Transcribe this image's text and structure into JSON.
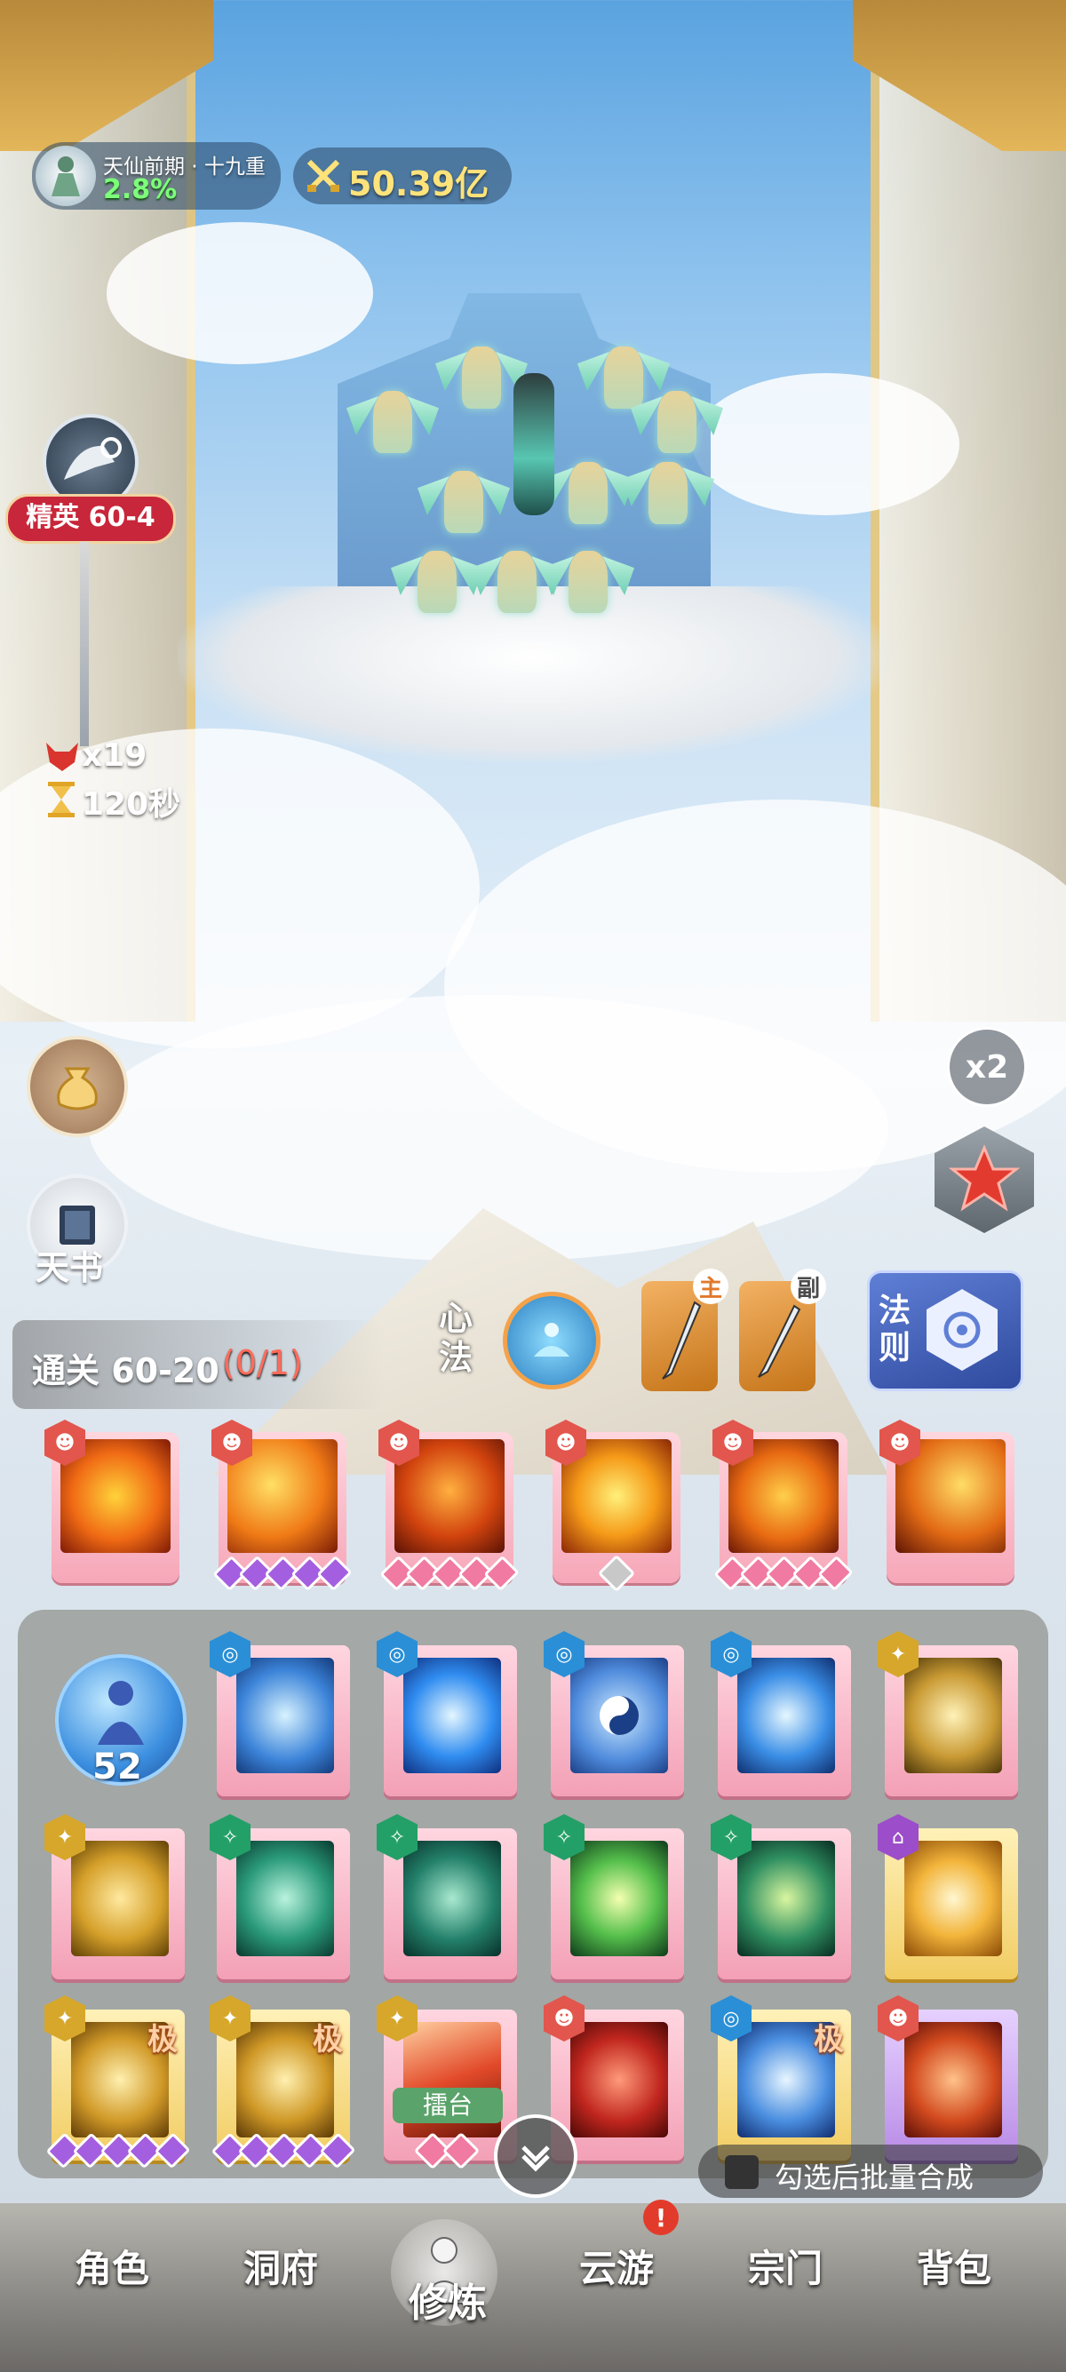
{
  "hud": {
    "realm_name": "天仙前期 · 十九重",
    "realm_progress": "2.8%",
    "power": "50.39亿"
  },
  "stage": {
    "name": "精英 60-4",
    "enemy_count": "x19",
    "time_left": "120秒"
  },
  "left_buttons": {
    "tianshu_label": "天书"
  },
  "right_buttons": {
    "speed_label": "x2"
  },
  "mission": {
    "text": "通关 60-20",
    "progress": "(0/1)"
  },
  "xinfa_label": "心法",
  "weapons": {
    "main_tag": "主",
    "sub_tag": "副"
  },
  "fa_ze_label": "法则",
  "panel": {
    "level": "52",
    "arena_label": "擂台",
    "batch_merge_label": "勾选后批量合成",
    "extreme_tag": "极"
  },
  "colors": {
    "accent_red": "#c8263a",
    "progress_green": "#7dff7a",
    "power_gold": "#ffe37a",
    "mission_red": "#ff6b5a",
    "nav_badge": "#e23b2b"
  },
  "nav": {
    "items": [
      "角色",
      "洞府",
      "修炼",
      "云游",
      "宗门",
      "背包"
    ],
    "badge": "!"
  }
}
